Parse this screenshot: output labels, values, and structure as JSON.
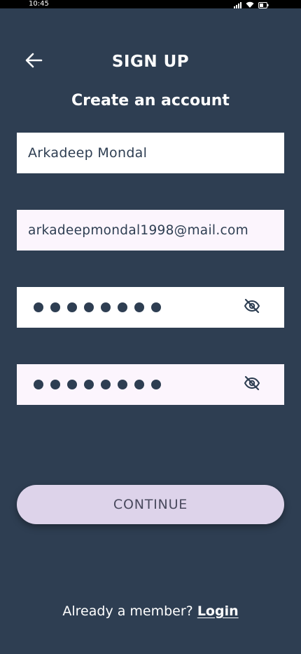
{
  "status_bar": {
    "time": "10:45",
    "icons": [
      "signal-icon",
      "wifi-icon",
      "battery-icon"
    ]
  },
  "header": {
    "back_icon": "arrow-left-icon",
    "title": "SIGN UP"
  },
  "subtitle": "Create an account",
  "form": {
    "name_value": "Arkadeep Mondal",
    "email_value": "arkadeepmondal1998@mail.com",
    "password_mask_count": 8,
    "confirm_mask_count": 8,
    "visibility_icon": "eye-off-icon"
  },
  "continue_label": "CONTINUE",
  "footer": {
    "prompt": "Already a member?",
    "login_label": "Login"
  },
  "colors": {
    "background": "#2e3e52",
    "field_white": "#ffffff",
    "field_tint": "#fcf5fd",
    "button": "#ddd3ea",
    "text_dark": "#2e3e52"
  }
}
